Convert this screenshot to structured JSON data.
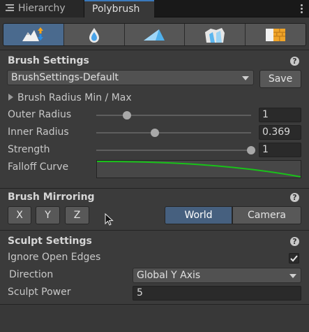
{
  "tabs": {
    "hierarchy": "Hierarchy",
    "polybrush": "Polybrush"
  },
  "modes": [
    {
      "icon": "sculpt-mode-icon",
      "active": true
    },
    {
      "icon": "smooth-mode-icon",
      "active": false
    },
    {
      "icon": "paint-vertex-colors-icon",
      "active": false
    },
    {
      "icon": "scatter-prefab-icon",
      "active": false
    },
    {
      "icon": "paint-textures-icon",
      "active": false
    }
  ],
  "brush_settings": {
    "heading": "Brush Settings",
    "preset": "BrushSettings-Default",
    "save_label": "Save",
    "radius_foldout": "Brush Radius Min / Max",
    "outer_radius": {
      "label": "Outer Radius",
      "value": "1",
      "fraction": 0.2
    },
    "inner_radius": {
      "label": "Inner Radius",
      "value": "0.369",
      "fraction": 0.38
    },
    "strength": {
      "label": "Strength",
      "value": "1",
      "fraction": 1.0
    },
    "falloff_label": "Falloff Curve",
    "curve_color": "#19c219"
  },
  "brush_mirroring": {
    "heading": "Brush Mirroring",
    "axes": [
      "X",
      "Y",
      "Z"
    ],
    "world": "World",
    "camera": "Camera",
    "selected_space": "World"
  },
  "sculpt_settings": {
    "heading": "Sculpt Settings",
    "ignore_open_edges": {
      "label": "Ignore Open Edges",
      "checked": true
    },
    "direction": {
      "label": "Direction",
      "value": "Global Y Axis"
    },
    "sculpt_power": {
      "label": "Sculpt Power",
      "value": "5"
    }
  },
  "colors": {
    "accent": "#3a79bb",
    "selected_button": "#46607f"
  }
}
